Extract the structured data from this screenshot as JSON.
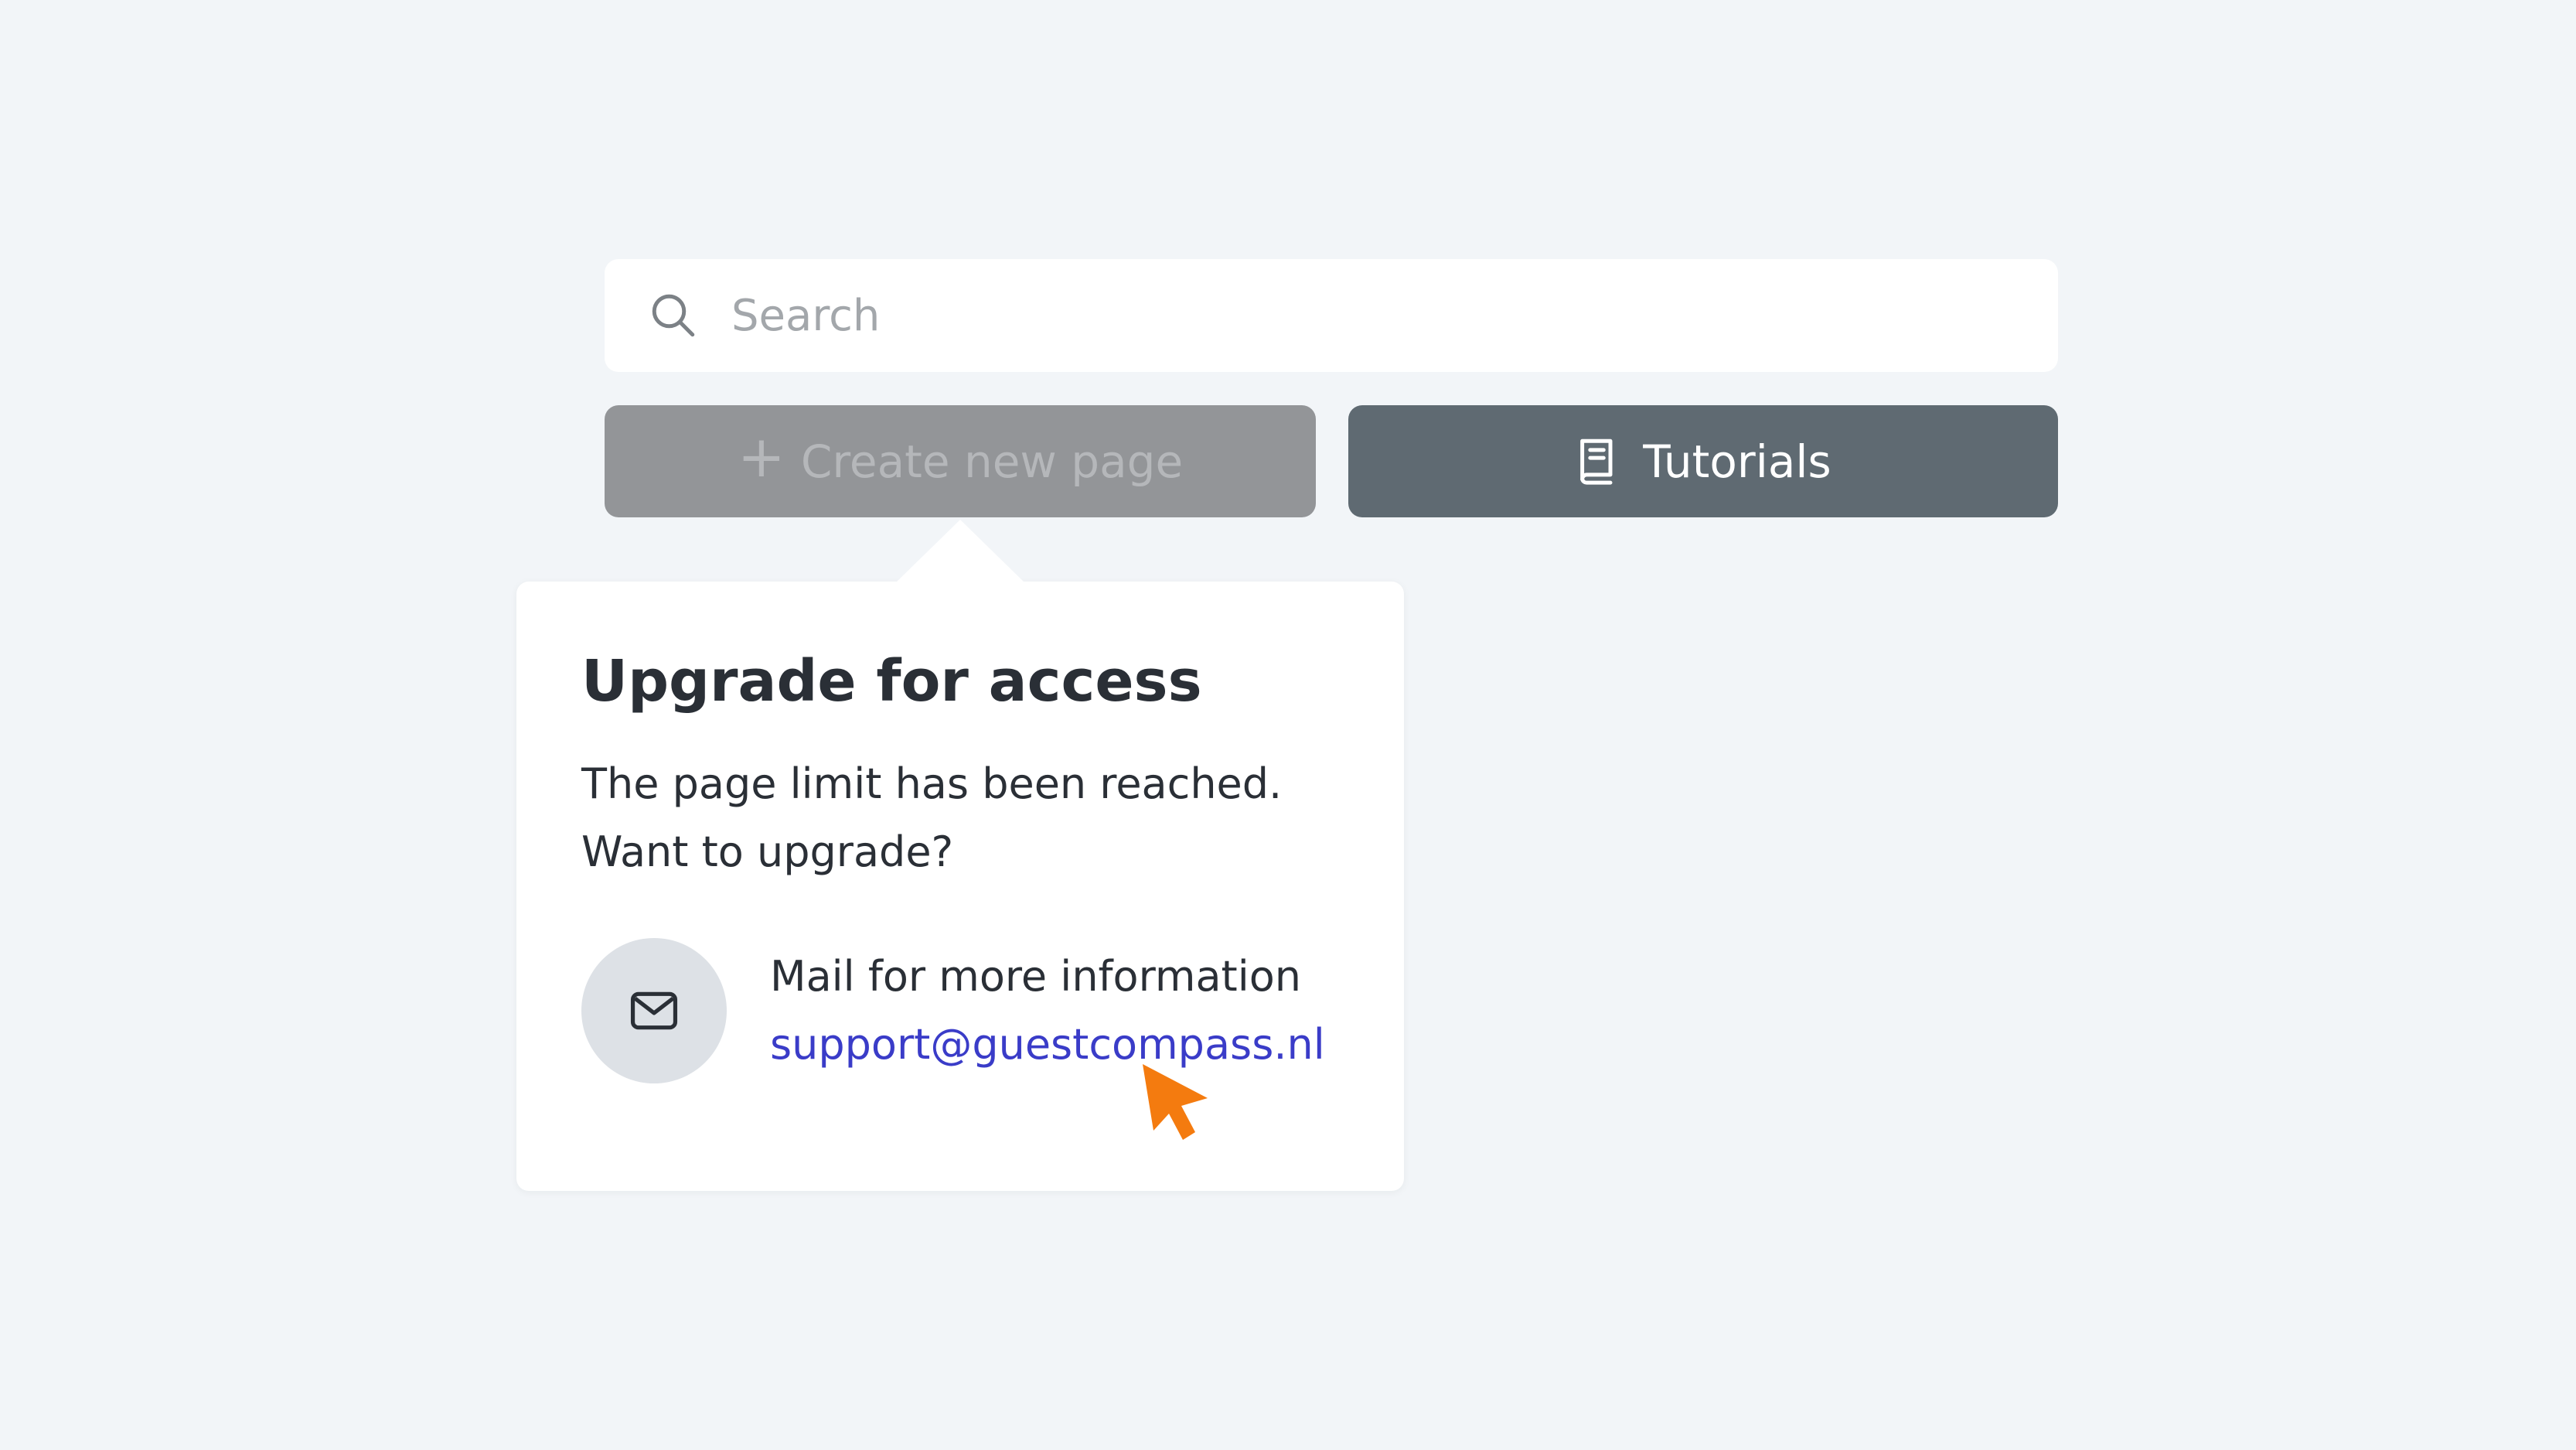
{
  "search": {
    "placeholder": "Search",
    "value": ""
  },
  "actions": {
    "create_label": "Create new page",
    "create_icon": "plus-icon",
    "tutorials_label": "Tutorials",
    "tutorials_icon": "book-icon"
  },
  "popover": {
    "title": "Upgrade for access",
    "message": "The page limit has been reached. Want to upgrade?",
    "mail_icon": "mail-icon",
    "mail_caption": "Mail for more information",
    "mail_link": "support@guestcompass.nl"
  },
  "colors": {
    "background": "#f2f5f8",
    "create_button_disabled": "#939598",
    "tutorials_button": "#5f6a72",
    "link": "#3a3cc8",
    "cursor": "#f47b0f"
  }
}
